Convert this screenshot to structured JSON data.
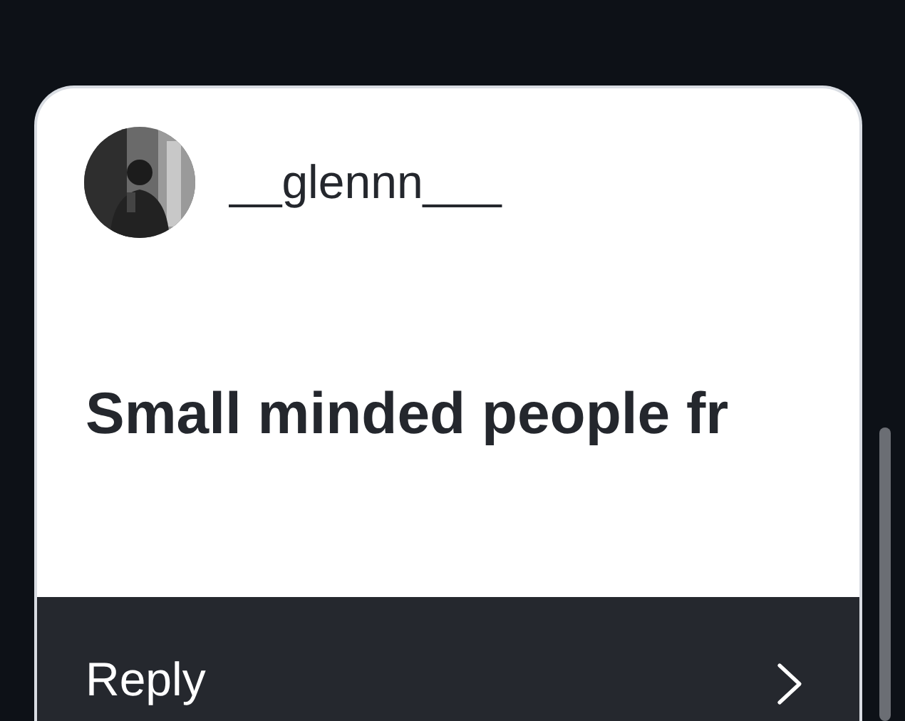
{
  "post": {
    "username": "__glennn___",
    "text": "Small minded people fr"
  },
  "footer": {
    "label": "Reply"
  }
}
